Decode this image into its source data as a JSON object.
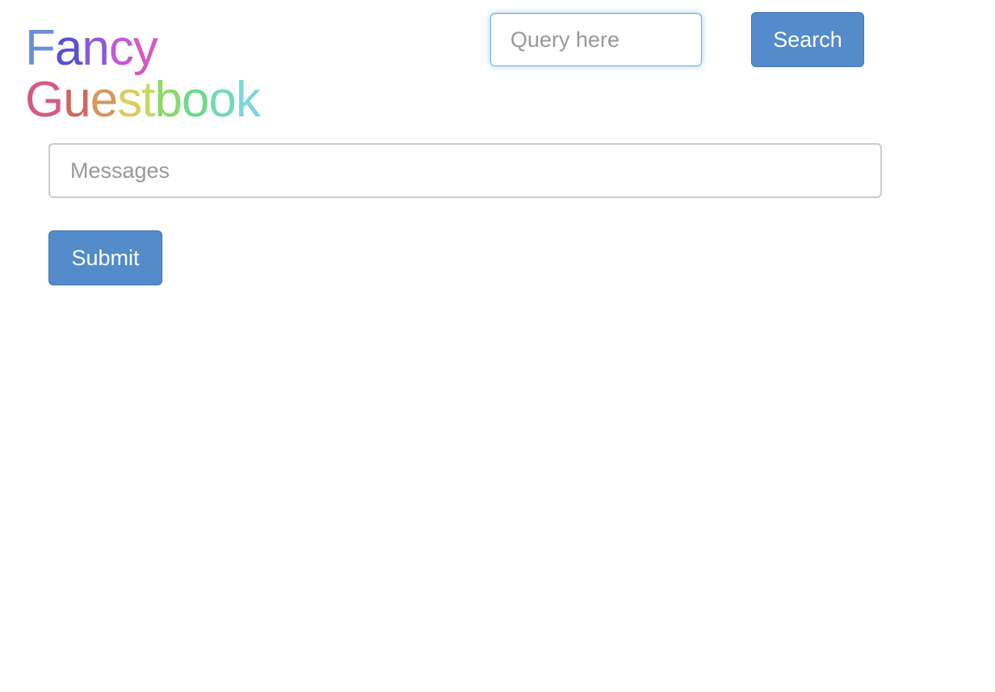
{
  "title": {
    "line1": "Fancy",
    "line2": "Guestbook",
    "line1_colors": [
      "#6a8fd8",
      "#5b4fd6",
      "#8d58d6",
      "#c35bd3",
      "#d35bbf"
    ],
    "line2_colors": [
      "#d35a86",
      "#d36460",
      "#d99660",
      "#dccd62",
      "#c6d966",
      "#8cd868",
      "#6fd98c",
      "#74d9b6",
      "#7cd6dc"
    ]
  },
  "search": {
    "placeholder": "Query here",
    "value": "",
    "button_label": "Search"
  },
  "form": {
    "message_placeholder": "Messages",
    "message_value": "",
    "submit_label": "Submit"
  },
  "colors": {
    "button": "#538bcb",
    "focus_border": "#66afe9"
  }
}
